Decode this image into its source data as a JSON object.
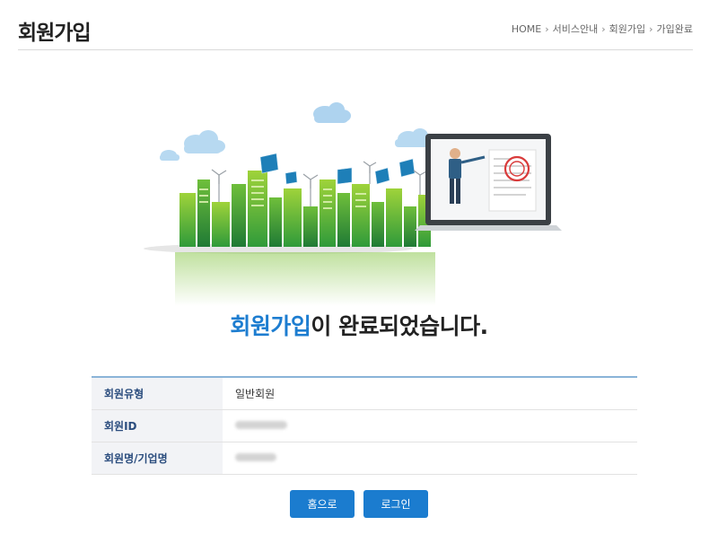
{
  "header": {
    "title": "회원가입",
    "breadcrumb": [
      "HOME",
      "서비스안내",
      "회원가입",
      "가입완료"
    ]
  },
  "message": {
    "accent": "회원가입",
    "rest": "이 완료되었습니다."
  },
  "info": {
    "rows": [
      {
        "label": "회원유형",
        "value": "일반회원"
      },
      {
        "label": "회원ID",
        "value": ""
      },
      {
        "label": "회원명/기업명",
        "value": ""
      }
    ]
  },
  "buttons": {
    "home": "홈으로",
    "login": "로그인"
  },
  "colors": {
    "accent": "#1d7dd0",
    "button": "#1b7ccf",
    "table_label": "#2b4d7e"
  }
}
